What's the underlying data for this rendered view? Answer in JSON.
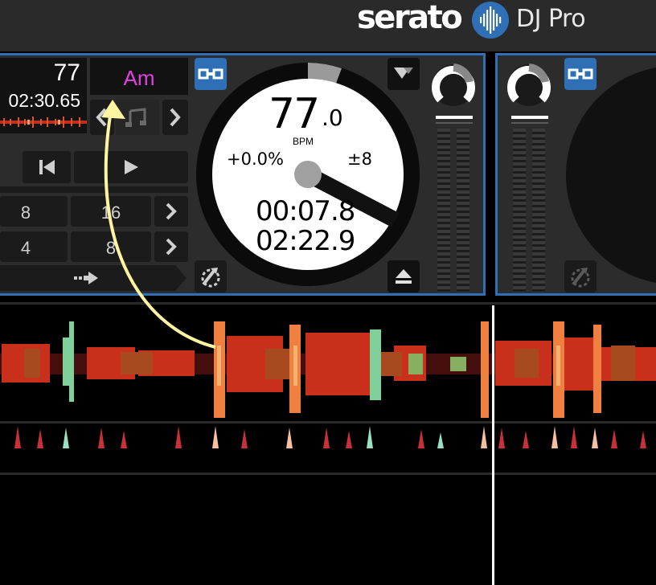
{
  "header": {
    "logo_text": "serato",
    "logo_subtitle": "DJ Pro"
  },
  "deck_left": {
    "bpm_display": "77",
    "time_display": "02:30.65",
    "key_display": "Am",
    "loop_row_1": [
      "8",
      "16"
    ],
    "loop_row_2": [
      "4",
      "8"
    ]
  },
  "platter": {
    "bpm_integer": "77",
    "bpm_decimal": ".0",
    "bpm_label": "BPM",
    "pitch_percent": "+0.0%",
    "pitch_range": "±8",
    "elapsed_time": "00:07.8",
    "remaining_time": "02:22.9"
  },
  "colors": {
    "accent_blue": "#2f6fb5",
    "key_magenta": "#e040e0",
    "annotation_yellow": "#fff5a0"
  }
}
